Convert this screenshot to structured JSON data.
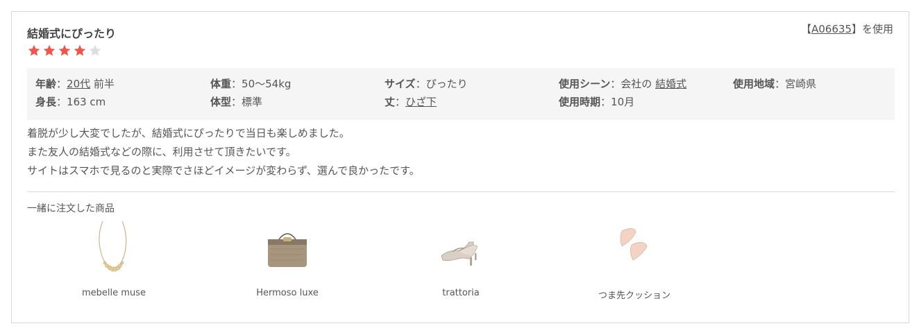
{
  "review": {
    "title": "結婚式にぴったり",
    "product_ref": {
      "open": "【",
      "code": "A06635",
      "close": "】を使用"
    },
    "rating": {
      "value": 4,
      "max": 5,
      "filled_color": "#f0564a",
      "empty_color": "#dddddd"
    },
    "specs": {
      "age": {
        "label": "年齢",
        "sep": "：",
        "value_link": "20代",
        "suffix": " 前半"
      },
      "height": {
        "label": "身長",
        "sep": "：",
        "value": "163 cm"
      },
      "weight": {
        "label": "体重",
        "sep": "：",
        "value": "50〜54kg"
      },
      "body_type": {
        "label": "体型",
        "sep": "：",
        "value": "標準"
      },
      "size": {
        "label": "サイズ",
        "sep": "：",
        "value": "ぴったり"
      },
      "length": {
        "label": "丈",
        "sep": "：",
        "value_link": "ひざ下"
      },
      "scene": {
        "label": "使用シーン",
        "sep": "：",
        "prefix": "会社の ",
        "value_link": "結婚式"
      },
      "time": {
        "label": "使用時期",
        "sep": "：",
        "value": "10月"
      },
      "region": {
        "label": "使用地域",
        "sep": "：",
        "value": "宮崎県"
      }
    },
    "comment_lines": [
      "着脱が少し大変でしたが、結婚式にぴったりで当日も楽しめました。",
      "また友人の結婚式などの際に、利用させて頂きたいです。",
      "サイトはスマホで見るのと実際でさほどイメージが変わらず、選んで良かったです。"
    ],
    "related": {
      "title": "一緒に注文した商品",
      "products": [
        {
          "name": "mebelle muse",
          "icon": "necklace-image"
        },
        {
          "name": "Hermoso luxe",
          "icon": "clutch-bag-image"
        },
        {
          "name": "trattoria",
          "icon": "heels-image"
        },
        {
          "name": "つま先クッション",
          "icon": "toe-cushion-image"
        }
      ]
    }
  }
}
